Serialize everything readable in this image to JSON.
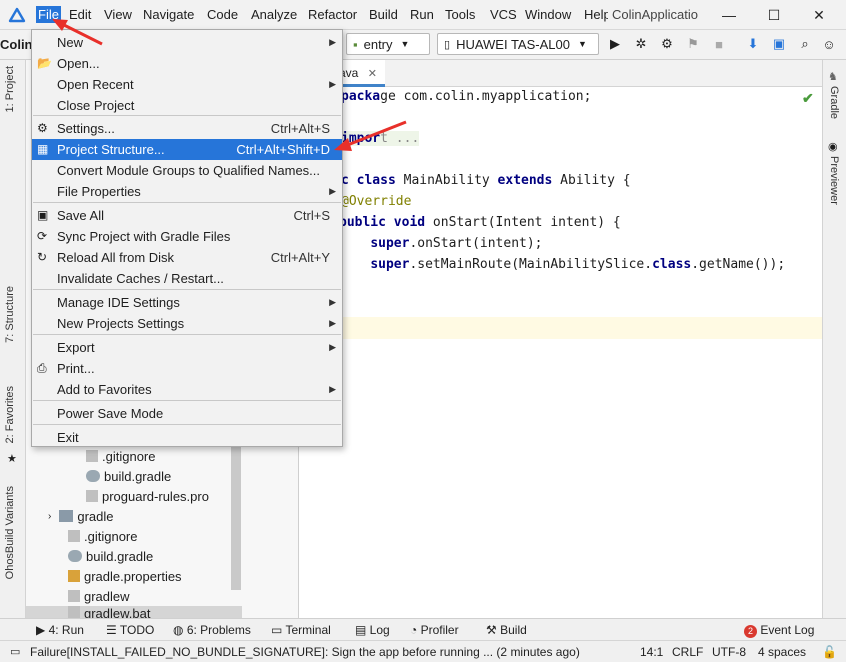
{
  "menubar": {
    "items": [
      "File",
      "Edit",
      "View",
      "Navigate",
      "Code",
      "Analyze",
      "Refactor",
      "Build",
      "Run",
      "Tools",
      "VCS",
      "Window",
      "Help"
    ],
    "window_title": "ColinApplicatio",
    "minimize": "—",
    "maximize": "☐",
    "close": "✕"
  },
  "toolbar": {
    "project_crumb": "ColinA",
    "run_config": "entry",
    "device": "HUAWEI TAS-AL00"
  },
  "left_tool_tabs": [
    "1: Project",
    "7: Structure",
    "2: Favorites",
    "OhosBuild Variants"
  ],
  "right_tool_tabs": [
    "Gradle",
    "Previewer"
  ],
  "project_tree": [
    {
      "label": ".gitignore",
      "indent": 2
    },
    {
      "label": "build.gradle",
      "indent": 2
    },
    {
      "label": "proguard-rules.pro",
      "indent": 2
    },
    {
      "label": "gradle",
      "indent": 1
    },
    {
      "label": ".gitignore",
      "indent": 1
    },
    {
      "label": "build.gradle",
      "indent": 1
    },
    {
      "label": "gradle.properties",
      "indent": 1
    },
    {
      "label": "gradlew",
      "indent": 1
    },
    {
      "label": "gradlew.bat",
      "indent": 1
    }
  ],
  "editor": {
    "tab_label": "ava",
    "tab_close": "✕",
    "lines": [
      {
        "pre": "",
        "kw": "",
        "text": "ge com.colin.myapplication;"
      },
      {
        "pre": "",
        "kw": "",
        "text": "t ..."
      },
      {
        "pre": "",
        "kw": "c class ",
        "text": "MainAbility "
      },
      {
        "pre": "",
        "kw": "",
        "text": "@Override"
      },
      {
        "pre": "",
        "kw": "public void ",
        "text": "onStart(Intent intent) {"
      },
      {
        "pre": "    ",
        "kw": "super",
        "text": ".onStart(intent);"
      },
      {
        "pre": "    ",
        "kw": "super",
        "text": ".setMainRoute(MainAbilitySlice."
      }
    ],
    "extends_kw": "extends",
    "ability": " Ability {",
    "class_kw": "class",
    "getname": ".getName());"
  },
  "file_menu": {
    "items": [
      {
        "label": "New",
        "shortcut": "",
        "submenu": true,
        "icon": ""
      },
      {
        "label": "Open...",
        "shortcut": "",
        "submenu": false,
        "icon": "folder-icon"
      },
      {
        "label": "Open Recent",
        "shortcut": "",
        "submenu": true,
        "icon": ""
      },
      {
        "label": "Close Project",
        "shortcut": "",
        "submenu": false,
        "icon": ""
      },
      {
        "label": "Settings...",
        "shortcut": "Ctrl+Alt+S",
        "submenu": false,
        "icon": "gear-icon"
      },
      {
        "label": "Project Structure...",
        "shortcut": "Ctrl+Alt+Shift+D",
        "submenu": false,
        "icon": "project-structure-icon"
      },
      {
        "label": "Convert Module Groups to Qualified Names...",
        "shortcut": "",
        "submenu": false,
        "icon": ""
      },
      {
        "label": "File Properties",
        "shortcut": "",
        "submenu": true,
        "icon": ""
      },
      {
        "label": "Save All",
        "shortcut": "Ctrl+S",
        "submenu": false,
        "icon": "save-icon"
      },
      {
        "label": "Sync Project with Gradle Files",
        "shortcut": "",
        "submenu": false,
        "icon": "sync-icon"
      },
      {
        "label": "Reload All from Disk",
        "shortcut": "Ctrl+Alt+Y",
        "submenu": false,
        "icon": "reload-icon"
      },
      {
        "label": "Invalidate Caches / Restart...",
        "shortcut": "",
        "submenu": false,
        "icon": ""
      },
      {
        "label": "Manage IDE Settings",
        "shortcut": "",
        "submenu": true,
        "icon": ""
      },
      {
        "label": "New Projects Settings",
        "shortcut": "",
        "submenu": true,
        "icon": ""
      },
      {
        "label": "Export",
        "shortcut": "",
        "submenu": true,
        "icon": ""
      },
      {
        "label": "Print...",
        "shortcut": "",
        "submenu": false,
        "icon": "print-icon"
      },
      {
        "label": "Add to Favorites",
        "shortcut": "",
        "submenu": true,
        "icon": ""
      },
      {
        "label": "Power Save Mode",
        "shortcut": "",
        "submenu": false,
        "icon": ""
      },
      {
        "label": "Exit",
        "shortcut": "",
        "submenu": false,
        "icon": ""
      }
    ],
    "highlighted": "Project Structure..."
  },
  "bottom_tools": [
    "4: Run",
    "TODO",
    "6: Problems",
    "Terminal",
    "Log",
    "Profiler",
    "Build",
    "Event Log"
  ],
  "event_log_count": "2",
  "status_bar": {
    "message": "Failure[INSTALL_FAILED_NO_BUNDLE_SIGNATURE]: Sign the app before running ... (2 minutes ago)",
    "position": "14:1",
    "line_sep": "CRLF",
    "encoding": "UTF-8",
    "indent": "4 spaces"
  },
  "colors": {
    "accent": "#2675d9",
    "keyword": "#000080",
    "annotation": "#808000",
    "annotation_arrow": "#e8302a"
  }
}
